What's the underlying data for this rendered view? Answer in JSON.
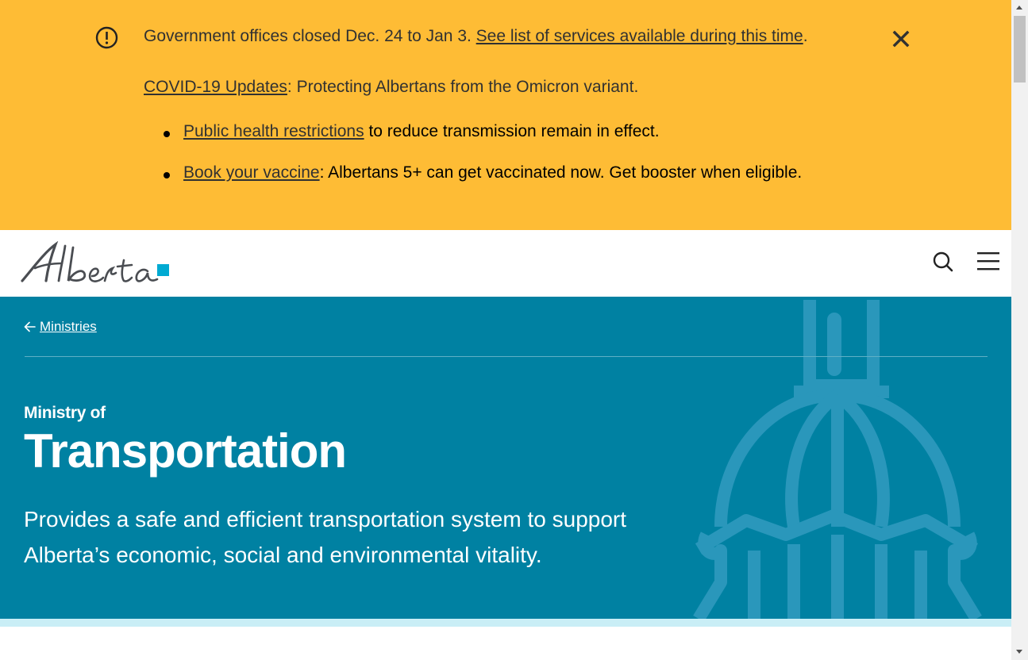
{
  "alert": {
    "closure_text": "Government offices closed Dec. 24 to Jan 3. ",
    "closure_link": "See list of services available during this time",
    "closure_end": ".",
    "covid_link": "COVID-19 Updates",
    "covid_text": ": Protecting Albertans from the Omicron variant.",
    "bullets": [
      {
        "link": "Public health restrictions",
        "text": " to reduce transmission remain in effect."
      },
      {
        "link": "Book your vaccine",
        "text": ": Albertans 5+ can get vaccinated now. Get booster when eligible."
      }
    ],
    "icons": {
      "alert": "exclamation-circle-icon",
      "close": "close-icon"
    }
  },
  "header": {
    "logo_text": "Alberta",
    "icons": {
      "search": "search-icon",
      "menu": "hamburger-menu-icon"
    }
  },
  "hero": {
    "back_link": "Ministries",
    "eyebrow": "Ministry of",
    "title": "Transportation",
    "description": "Provides a safe and efficient transportation system to support Alberta’s economic, social and environmental vitality."
  },
  "colors": {
    "alert_bg": "#febc35",
    "hero_bg": "#0081a2",
    "hero_bottom_band": "#c9eef6",
    "logo_accent": "#00aad2"
  }
}
